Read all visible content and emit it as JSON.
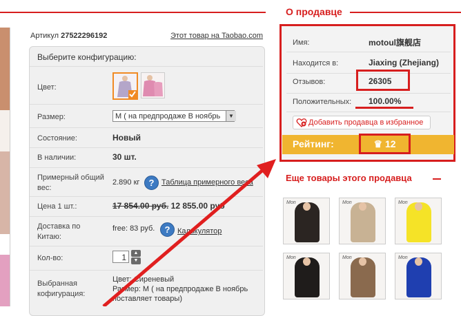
{
  "article": {
    "label": "Артикул",
    "number": "27522296192",
    "taobao_link": "Этот товар на Taobao.com"
  },
  "config": {
    "title": "Выберите конфигурацию:",
    "color_label": "Цвет:",
    "size_label": "Размер:",
    "size_value": "M ( на предпродаже В ноябрь",
    "condition_label": "Состояние:",
    "condition_value": "Новый",
    "stock_label": "В наличии:",
    "stock_value": "30 шт.",
    "weight_label": "Примерный общий вес:",
    "weight_value": "2.890 кг",
    "weight_table_link": "Таблица примерного веса",
    "price_label": "Цена 1 шт.:",
    "price_old": "17 854.00 руб.",
    "price_new": "12 855.00 руб",
    "delivery_label": "Доставка по Китаю:",
    "delivery_value": "free: 83 руб.",
    "calculator_link": "Калькулятор",
    "qty_label": "Кол-во:",
    "qty_value": "1",
    "selected_label": "Выбранная кофигурация:",
    "selected_color": "Цвет: Сиреневый",
    "selected_size": "Размер: M ( на предпродаже В ноябрь",
    "selected_note": "поставляет товары)"
  },
  "seller": {
    "title": "О продавце",
    "name_label": "Имя:",
    "name_value": "motoul旗舰店",
    "location_label": "Находится в:",
    "location_value": "Jiaxing (Zhejiang)",
    "reviews_label": "Отзывов:",
    "reviews_value": "26305",
    "positive_label": "Положительных:",
    "positive_value": "100.00%",
    "favorite_button": "Добавить продавца в избранное",
    "rating_label": "Рейтинг:",
    "rating_value": "12"
  },
  "more": {
    "title": "Еще товары этого продавца",
    "tag": "Mon"
  },
  "colors": {
    "accent": "#d71e1e",
    "rating_bar": "#f0b530",
    "help_icon": "#3d7ac2"
  }
}
